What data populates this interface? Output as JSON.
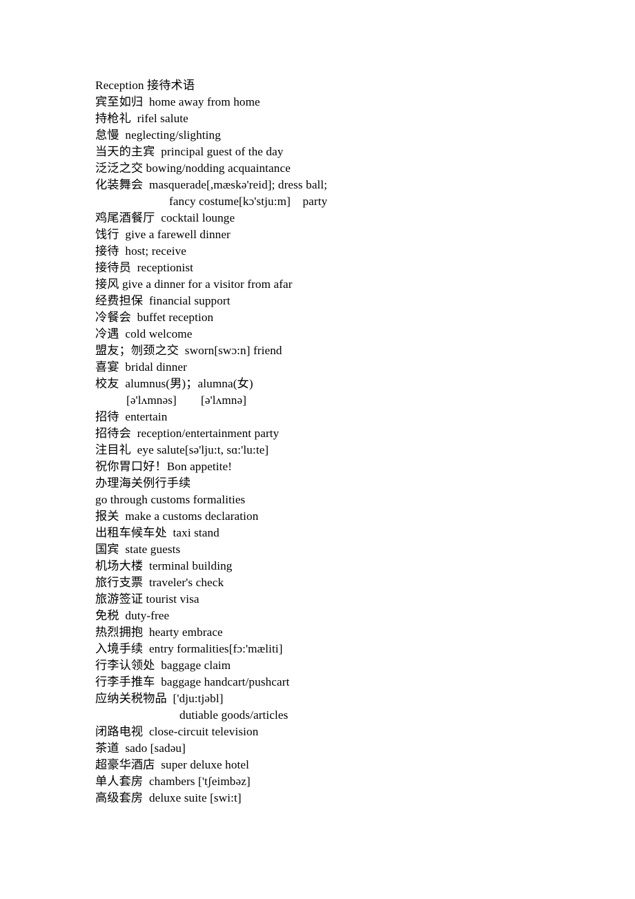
{
  "document": {
    "title": "Reception 接待术语",
    "page_background": "#ffffff",
    "text_color": "#000000",
    "lines": [
      {
        "id": "l01",
        "text": "Reception 接待术语",
        "indent": "none"
      },
      {
        "id": "l02",
        "text": "宾至如归  home away from home",
        "indent": "none"
      },
      {
        "id": "l03",
        "text": "持枪礼  rifel salute",
        "indent": "none"
      },
      {
        "id": "l04",
        "text": "怠慢  neglecting/slighting",
        "indent": "none"
      },
      {
        "id": "l05",
        "text": "当天的主宾  principal guest of the day",
        "indent": "none"
      },
      {
        "id": "l06",
        "text": "泛泛之交 bowing/nodding acquaintance",
        "indent": "none"
      },
      {
        "id": "l07",
        "text": "化装舞会  masquerade[,mæskə'reid]; dress ball;",
        "indent": "none"
      },
      {
        "id": "l08",
        "text": "fancy costume[kɔ'stju:m]    party",
        "indent": "costume"
      },
      {
        "id": "l09",
        "text": "鸡尾酒餐厅  cocktail lounge",
        "indent": "none"
      },
      {
        "id": "l10",
        "text": "饯行  give a farewell dinner",
        "indent": "none"
      },
      {
        "id": "l11",
        "text": "接待  host; receive",
        "indent": "none"
      },
      {
        "id": "l12",
        "text": "接待员  receptionist",
        "indent": "none"
      },
      {
        "id": "l13",
        "text": "接风 give a dinner for a visitor from afar",
        "indent": "none"
      },
      {
        "id": "l14",
        "text": "经费担保  financial support",
        "indent": "none"
      },
      {
        "id": "l15",
        "text": "冷餐会  buffet reception",
        "indent": "none"
      },
      {
        "id": "l16",
        "text": "冷遇  cold welcome",
        "indent": "none"
      },
      {
        "id": "l17",
        "text": "盟友；刎颈之交  sworn[swɔ:n] friend",
        "indent": "none"
      },
      {
        "id": "l18",
        "text": "喜宴  bridal dinner",
        "indent": "none"
      },
      {
        "id": "l19",
        "text": "校友  alumnus(男)；alumna(女)",
        "indent": "none"
      },
      {
        "id": "l20",
        "text": "[ə'lʌmnəs]        [ə'lʌmnə]",
        "indent": "alumni"
      },
      {
        "id": "l21",
        "text": "招待  entertain",
        "indent": "none"
      },
      {
        "id": "l22",
        "text": "招待会  reception/entertainment party",
        "indent": "none"
      },
      {
        "id": "l23",
        "text": "注目礼  eye salute[sə'lju:t, sɑ:'lu:te]",
        "indent": "none"
      },
      {
        "id": "l24",
        "text": "祝你胃口好！Bon appetite!",
        "indent": "none"
      },
      {
        "id": "l25",
        "text": "办理海关例行手续",
        "indent": "none"
      },
      {
        "id": "l26",
        "text": "go through customs formalities",
        "indent": "none"
      },
      {
        "id": "l27",
        "text": "报关  make a customs declaration",
        "indent": "none"
      },
      {
        "id": "l28",
        "text": "出租车候车处  taxi stand",
        "indent": "none"
      },
      {
        "id": "l29",
        "text": "国宾  state guests",
        "indent": "none"
      },
      {
        "id": "l30",
        "text": "机场大楼  terminal building",
        "indent": "none"
      },
      {
        "id": "l31",
        "text": "旅行支票  traveler's check",
        "indent": "none"
      },
      {
        "id": "l32",
        "text": "旅游签证 tourist visa",
        "indent": "none"
      },
      {
        "id": "l33",
        "text": "免税  duty-free",
        "indent": "none"
      },
      {
        "id": "l34",
        "text": "热烈拥抱  hearty embrace",
        "indent": "none"
      },
      {
        "id": "l35",
        "text": "入境手续  entry formalities[fɔ:'mæliti]",
        "indent": "none"
      },
      {
        "id": "l36",
        "text": "行李认领处  baggage claim",
        "indent": "none"
      },
      {
        "id": "l37",
        "text": "行李手推车  baggage handcart/pushcart",
        "indent": "none"
      },
      {
        "id": "l38",
        "text": "应纳关税物品  ['dju:tjəbl]",
        "indent": "none"
      },
      {
        "id": "l39",
        "text": "dutiable goods/articles",
        "indent": "dutiable"
      },
      {
        "id": "l40",
        "text": "闭路电视  close-circuit television",
        "indent": "none"
      },
      {
        "id": "l41",
        "text": "茶道  sado [sadəu]",
        "indent": "none"
      },
      {
        "id": "l42",
        "text": "超豪华酒店  super deluxe hotel",
        "indent": "none"
      },
      {
        "id": "l43",
        "text": "单人套房  chambers ['tʃeimbəz]",
        "indent": "none"
      },
      {
        "id": "l44",
        "text": "高级套房  deluxe suite [swi:t]",
        "indent": "none"
      }
    ]
  }
}
